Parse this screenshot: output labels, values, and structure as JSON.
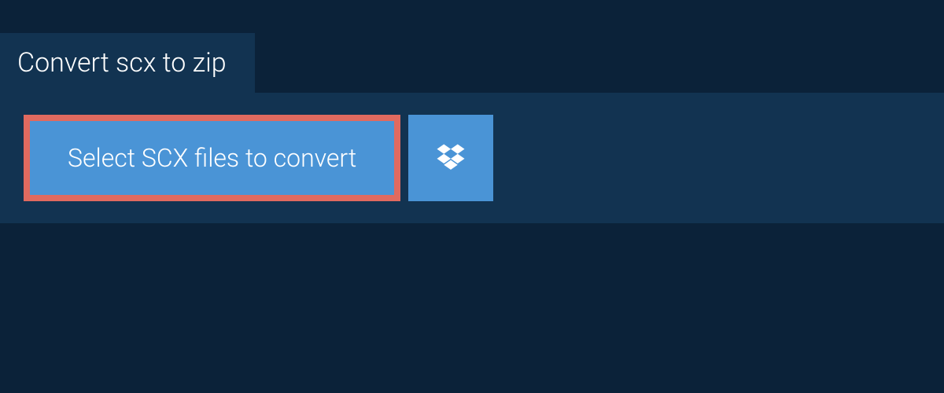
{
  "tab": {
    "label": "Convert scx to zip"
  },
  "actions": {
    "select_label": "Select SCX files to convert"
  }
}
